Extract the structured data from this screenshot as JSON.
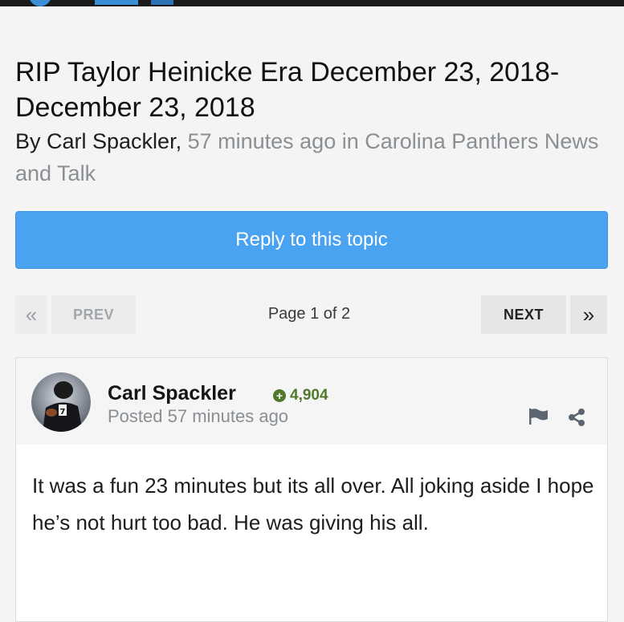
{
  "topic": {
    "title": "RIP Taylor Heinicke Era December 23, 2018- December 23, 2018",
    "by_prefix": "By Carl Spackler,",
    "meta": "57 minutes ago in Carolina Panthers News and Talk"
  },
  "reply_button": {
    "label": "Reply to this topic"
  },
  "pagination": {
    "first_icon": "«",
    "prev_label": "PREV",
    "page_label": "Page 1 of 2",
    "next_label": "NEXT",
    "last_icon": "»"
  },
  "post": {
    "author": "Carl Spackler",
    "reputation": "4,904",
    "posted": "Posted 57 minutes ago",
    "body": "It was a fun 23 minutes but its all over. All joking aside I hope he’s not hurt too bad. He was giving his all.",
    "icons": {
      "report": "flag-icon",
      "share": "share-icon",
      "reputation": "plus-circle-icon"
    }
  },
  "colors": {
    "accent": "#4aa3f0",
    "reputation": "#4f7a2d",
    "muted_text": "#8a8f94"
  }
}
